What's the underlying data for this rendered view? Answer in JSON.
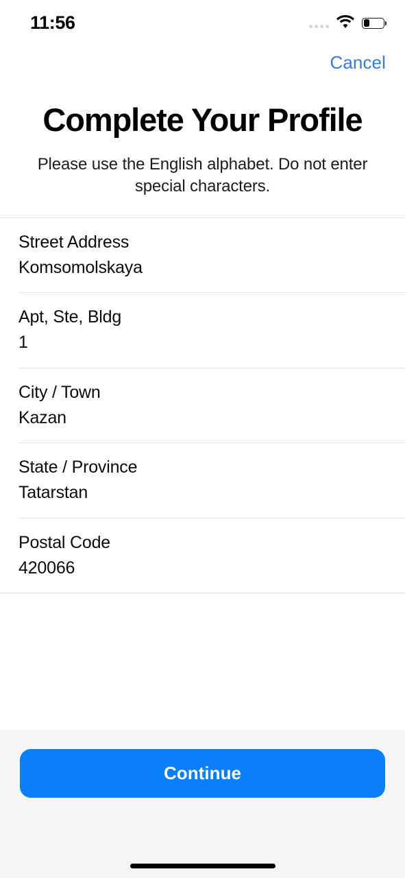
{
  "status_bar": {
    "time": "11:56",
    "signal_icon": "signal-dots-icon",
    "wifi_icon": "wifi-icon",
    "battery_icon": "battery-icon",
    "battery_level_percent": 30
  },
  "nav": {
    "cancel_label": "Cancel",
    "cancel_color": "#2f7cf6"
  },
  "header": {
    "title": "Complete Your Profile",
    "subtitle": "Please use the English alphabet. Do not enter special characters."
  },
  "form": {
    "fields": [
      {
        "label": "Street Address",
        "value": "Komsomolskaya"
      },
      {
        "label": "Apt, Ste, Bldg",
        "value": "1"
      },
      {
        "label": "City / Town",
        "value": "Kazan"
      },
      {
        "label": "State / Province",
        "value": "Tatarstan"
      },
      {
        "label": "Postal Code",
        "value": "420066"
      }
    ]
  },
  "footer": {
    "continue_label": "Continue",
    "continue_color": "#097ffa",
    "background_color": "#f5f5f6",
    "home_indicator": "home-indicator"
  }
}
